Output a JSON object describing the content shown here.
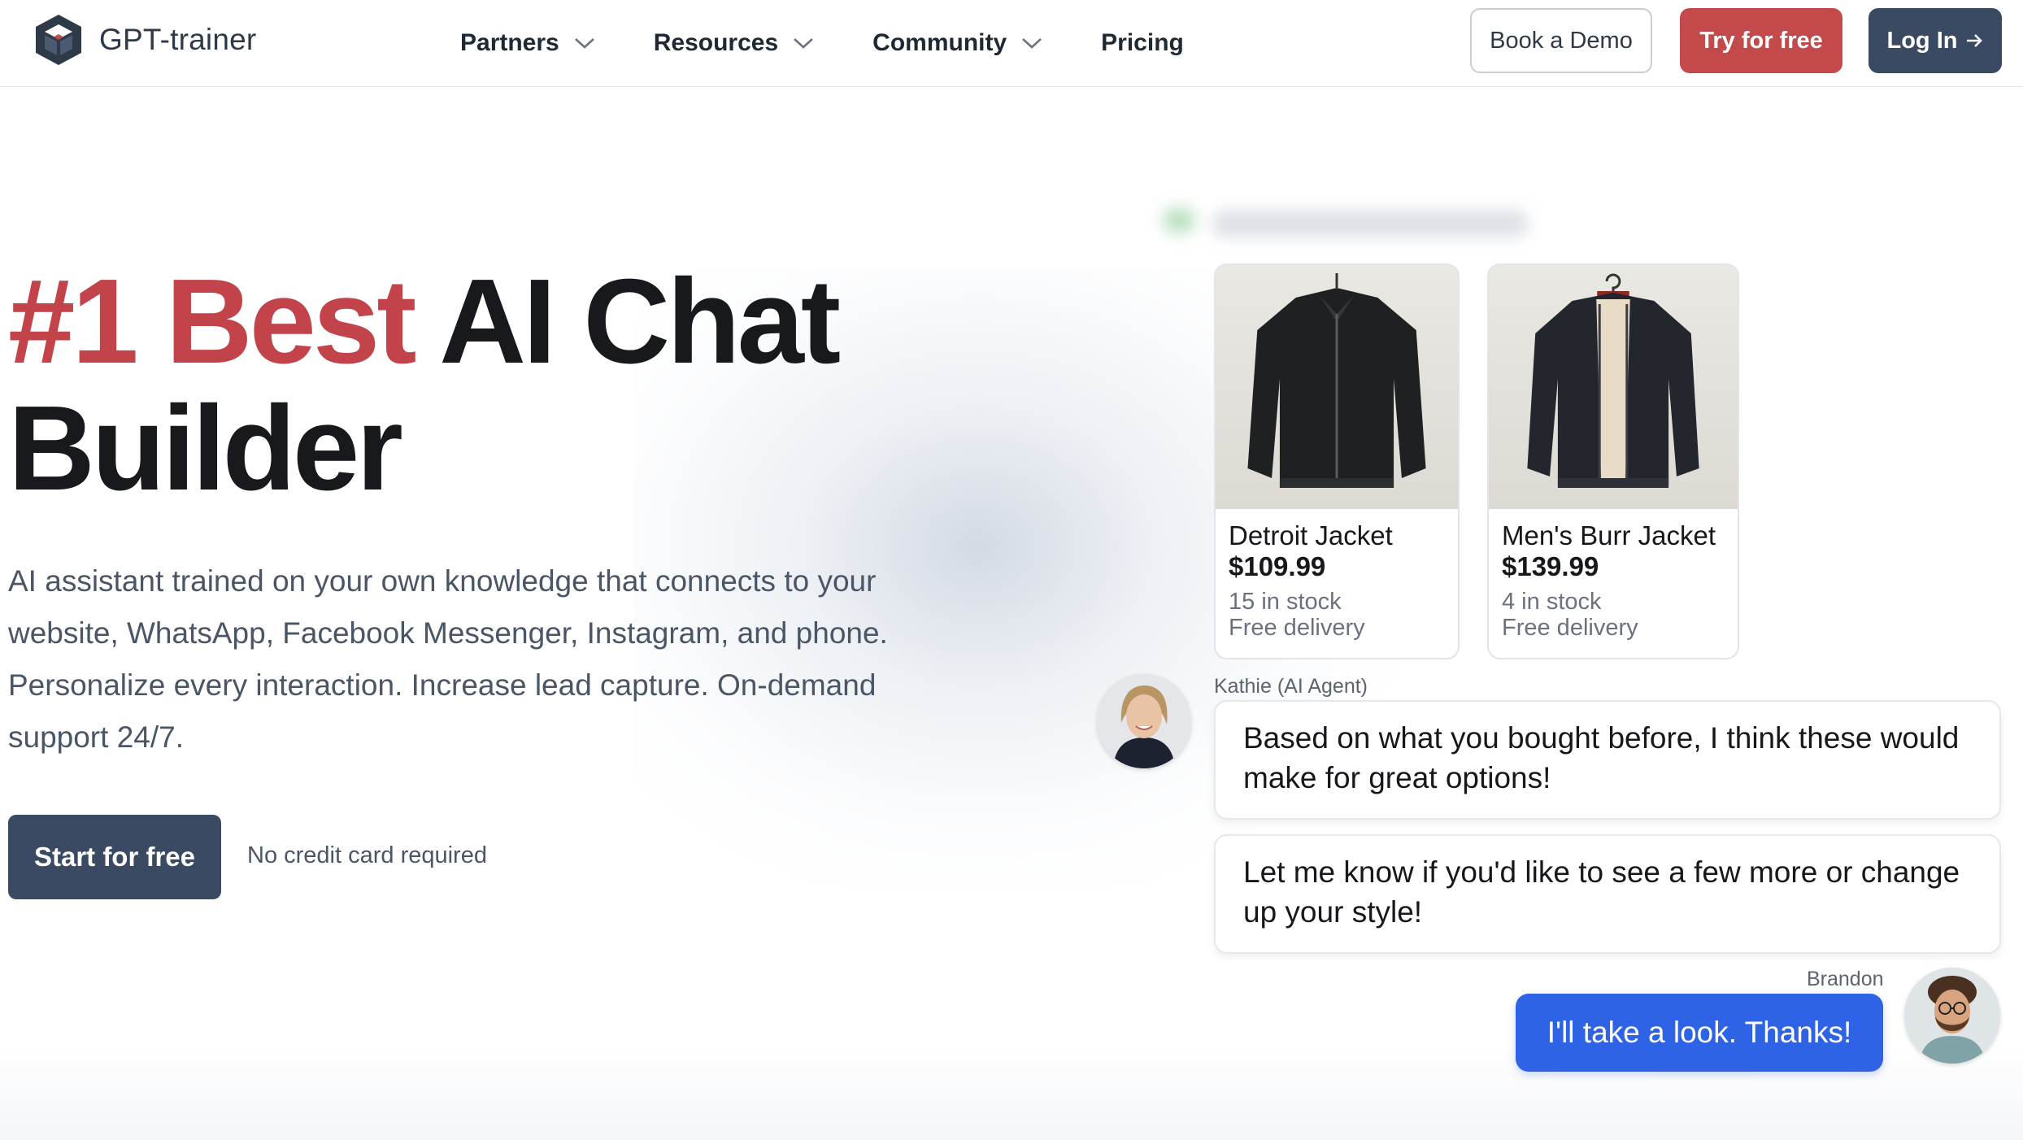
{
  "brand": {
    "name": "GPT-trainer",
    "logo_icon": "hexagon-cube-logo-icon",
    "colors": {
      "accent_red": "#c3494b",
      "slate": "#3a4a63",
      "chat_blue": "#2e63e6"
    }
  },
  "nav": {
    "items": [
      {
        "label": "Partners",
        "icon": "chevron-down-icon"
      },
      {
        "label": "Resources",
        "icon": "chevron-down-icon"
      },
      {
        "label": "Community",
        "icon": "chevron-down-icon"
      },
      {
        "label": "Pricing"
      }
    ],
    "book_demo": "Book a Demo",
    "try_free": "Try for free",
    "login": "Log In",
    "login_icon": "arrow-right-icon"
  },
  "hero": {
    "title_accent": "#1 Best",
    "title_rest": " AI Chat",
    "title_line2": "Builder",
    "subtitle": "AI assistant trained on your own knowledge that connects to your website, WhatsApp, Facebook Messenger, Instagram, and phone. Personalize every interaction. Increase lead capture. On-demand support 24/7.",
    "cta": "Start for free",
    "cta_note": "No credit card required"
  },
  "chat": {
    "products": [
      {
        "name": "Detroit Jacket",
        "price": "$109.99",
        "stock": "15 in stock",
        "delivery": "Free delivery"
      },
      {
        "name": "Men's Burr Jacket",
        "price": "$139.99",
        "stock": "4 in stock",
        "delivery": "Free delivery"
      }
    ],
    "agent_name": "Kathie (AI Agent)",
    "agent_messages": [
      "Based on what you bought before, I think these would make for great options!",
      "Let me know if you'd like to see a few more or change up your style!"
    ],
    "user_name": "Brandon",
    "user_message": "I'll take a look. Thanks!"
  }
}
